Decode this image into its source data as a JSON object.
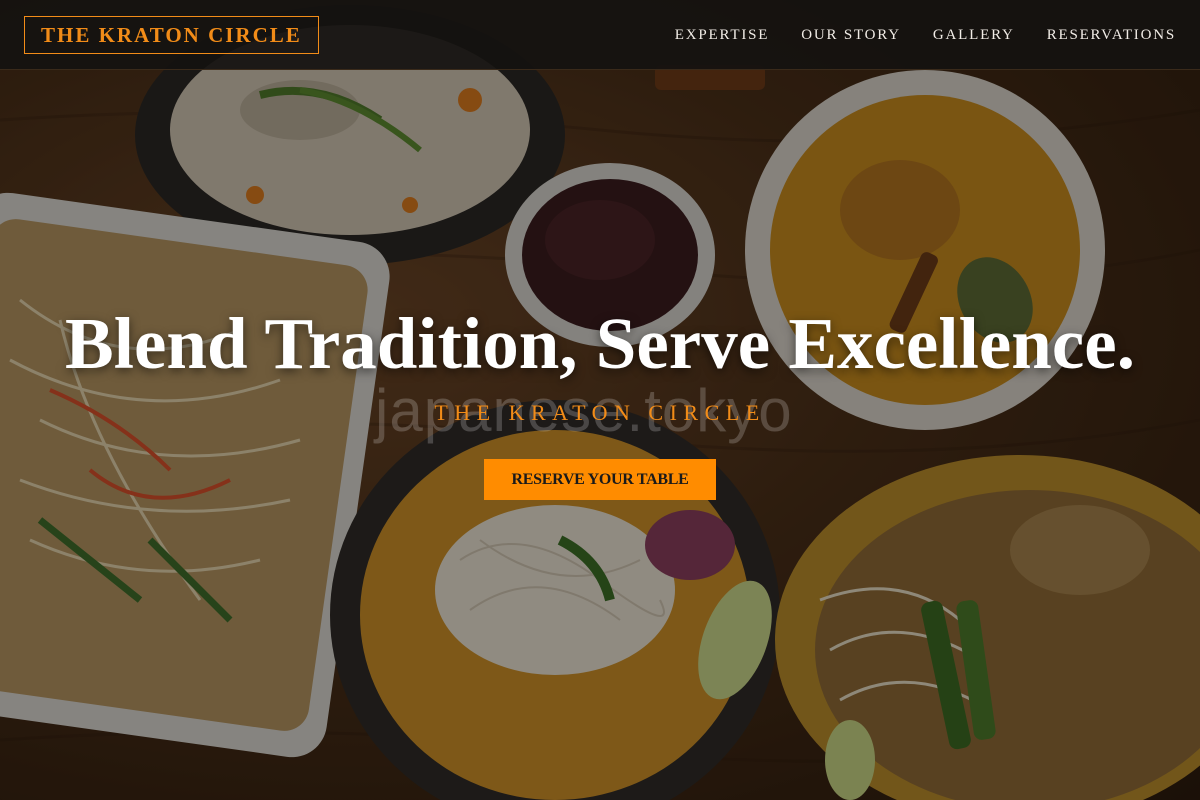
{
  "header": {
    "logo": "THE KRATON CIRCLE",
    "nav": [
      {
        "label": "EXPERTISE"
      },
      {
        "label": "OUR STORY"
      },
      {
        "label": "GALLERY"
      },
      {
        "label": "RESERVATIONS"
      }
    ]
  },
  "hero": {
    "title": "Blend Tradition, Serve Excellence.",
    "subtitle": "THE KRATON CIRCLE",
    "cta_label": "RESERVE YOUR TABLE",
    "watermark": "japanese.tokyo"
  },
  "colors": {
    "accent": "#ff8c00",
    "logo": "#f28c18",
    "header_bg": "#141210",
    "title_text": "#ffffff"
  }
}
